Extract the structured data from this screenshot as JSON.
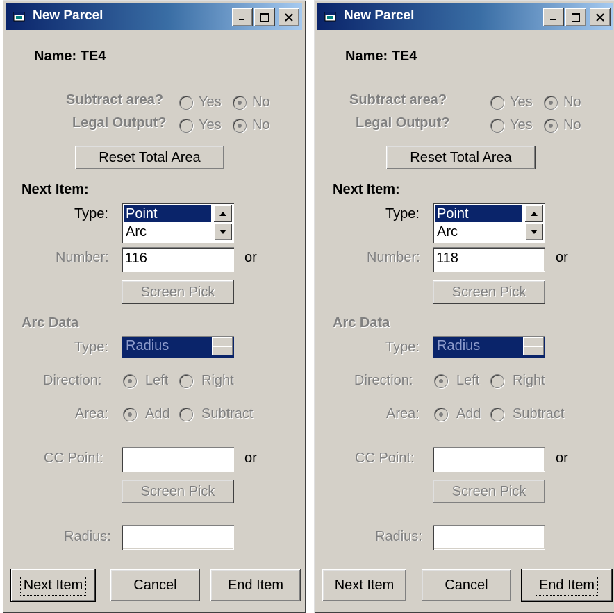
{
  "windows": [
    {
      "title": "New Parcel",
      "name_label": "Name: TE4",
      "subtract_area": {
        "label": "Subtract area?",
        "yes": "Yes",
        "no": "No",
        "selected": "No"
      },
      "legal_output": {
        "label": "Legal Output?",
        "yes": "Yes",
        "no": "No",
        "selected": "No"
      },
      "reset_button": "Reset Total Area",
      "next_item_heading": "Next Item:",
      "type_label": "Type:",
      "type_options": [
        "Point",
        "Arc"
      ],
      "type_selected": "Point",
      "number_label": "Number:",
      "number_value": "116",
      "or_text": "or",
      "screen_pick": "Screen Pick",
      "arc_heading": "Arc Data",
      "arc_type_label": "Type:",
      "arc_type_value": "Radius",
      "direction": {
        "label": "Direction:",
        "left": "Left",
        "right": "Right",
        "selected": "Left"
      },
      "area": {
        "label": "Area:",
        "add": "Add",
        "subtract": "Subtract",
        "selected": "Add"
      },
      "cc_point_label": "CC Point:",
      "cc_point_value": "",
      "cc_or_text": "or",
      "cc_screen_pick": "Screen Pick",
      "radius_label": "Radius:",
      "radius_value": "",
      "next_button": "Next Item",
      "cancel_button": "Cancel",
      "end_button": "End Item",
      "default_button": "next"
    },
    {
      "title": "New Parcel",
      "name_label": "Name: TE4",
      "subtract_area": {
        "label": "Subtract area?",
        "yes": "Yes",
        "no": "No",
        "selected": "No"
      },
      "legal_output": {
        "label": "Legal Output?",
        "yes": "Yes",
        "no": "No",
        "selected": "No"
      },
      "reset_button": "Reset Total Area",
      "next_item_heading": "Next Item:",
      "type_label": "Type:",
      "type_options": [
        "Point",
        "Arc"
      ],
      "type_selected": "Point",
      "number_label": "Number:",
      "number_value": "118",
      "or_text": "or",
      "screen_pick": "Screen Pick",
      "arc_heading": "Arc Data",
      "arc_type_label": "Type:",
      "arc_type_value": "Radius",
      "direction": {
        "label": "Direction:",
        "left": "Left",
        "right": "Right",
        "selected": "Left"
      },
      "area": {
        "label": "Area:",
        "add": "Add",
        "subtract": "Subtract",
        "selected": "Add"
      },
      "cc_point_label": "CC Point:",
      "cc_point_value": "",
      "cc_or_text": "or",
      "cc_screen_pick": "Screen Pick",
      "radius_label": "Radius:",
      "radius_value": "",
      "next_button": "Next Item",
      "cancel_button": "Cancel",
      "end_button": "End Item",
      "default_button": "end"
    }
  ]
}
